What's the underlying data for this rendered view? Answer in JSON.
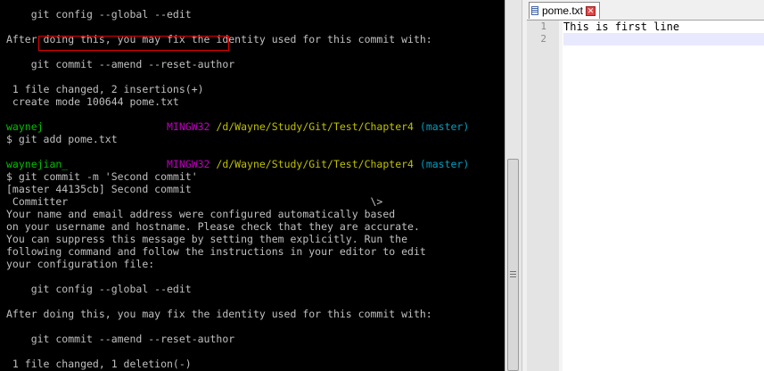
{
  "terminal": {
    "lines": [
      [
        {
          "t": "    git config --global --edit",
          "c": "white"
        }
      ],
      [
        {
          "t": "",
          "c": "white"
        }
      ],
      [
        {
          "t": "After doing this, you may fix the identity used for this commit with:",
          "c": "white"
        }
      ],
      [
        {
          "t": "",
          "c": "white"
        }
      ],
      [
        {
          "t": "    git commit --amend --reset-author",
          "c": "white"
        }
      ],
      [
        {
          "t": "",
          "c": "white"
        }
      ],
      [
        {
          "t": " 1 file changed, 2 insertions(+)",
          "c": "white"
        }
      ],
      [
        {
          "t": " create mode 100644 pome.txt",
          "c": "white"
        }
      ],
      [
        {
          "t": "",
          "c": "white"
        }
      ],
      [
        {
          "t": "waynej                    ",
          "c": "green"
        },
        {
          "t": "MINGW32 ",
          "c": "magenta"
        },
        {
          "t": "/d/Wayne/Study/Git/Test/Chapter4 ",
          "c": "yellow"
        },
        {
          "t": "(master)",
          "c": "cyan"
        }
      ],
      [
        {
          "t": "$ git add pome.txt",
          "c": "white"
        }
      ],
      [
        {
          "t": "",
          "c": "white"
        }
      ],
      [
        {
          "t": "waynejian_                ",
          "c": "green"
        },
        {
          "t": "MINGW32 ",
          "c": "magenta"
        },
        {
          "t": "/d/Wayne/Study/Git/Test/Chapter4 ",
          "c": "yellow"
        },
        {
          "t": "(master)",
          "c": "cyan"
        }
      ],
      [
        {
          "t": "$ git commit -m 'Second commit'",
          "c": "white"
        }
      ],
      [
        {
          "t": "[master 44135cb] Second commit",
          "c": "white"
        }
      ],
      [
        {
          "t": " Committer                                                 \\>",
          "c": "white"
        }
      ],
      [
        {
          "t": "Your name and email address were configured automatically based",
          "c": "white"
        }
      ],
      [
        {
          "t": "on your username and hostname. Please check that they are accurate.",
          "c": "white"
        }
      ],
      [
        {
          "t": "You can suppress this message by setting them explicitly. Run the",
          "c": "white"
        }
      ],
      [
        {
          "t": "following command and follow the instructions in your editor to edit",
          "c": "white"
        }
      ],
      [
        {
          "t": "your configuration file:",
          "c": "white"
        }
      ],
      [
        {
          "t": "",
          "c": "white"
        }
      ],
      [
        {
          "t": "    git config --global --edit",
          "c": "white"
        }
      ],
      [
        {
          "t": "",
          "c": "white"
        }
      ],
      [
        {
          "t": "After doing this, you may fix the identity used for this commit with:",
          "c": "white"
        }
      ],
      [
        {
          "t": "",
          "c": "white"
        }
      ],
      [
        {
          "t": "    git commit --amend --reset-author",
          "c": "white"
        }
      ],
      [
        {
          "t": "",
          "c": "white"
        }
      ],
      [
        {
          "t": " 1 file changed, 1 deletion(-)",
          "c": "white"
        }
      ]
    ]
  },
  "editor": {
    "tab_label": "pome.txt",
    "tab_close_glyph": "✕",
    "line_numbers": [
      "1",
      "2"
    ],
    "lines": [
      "This is first line",
      ""
    ]
  }
}
